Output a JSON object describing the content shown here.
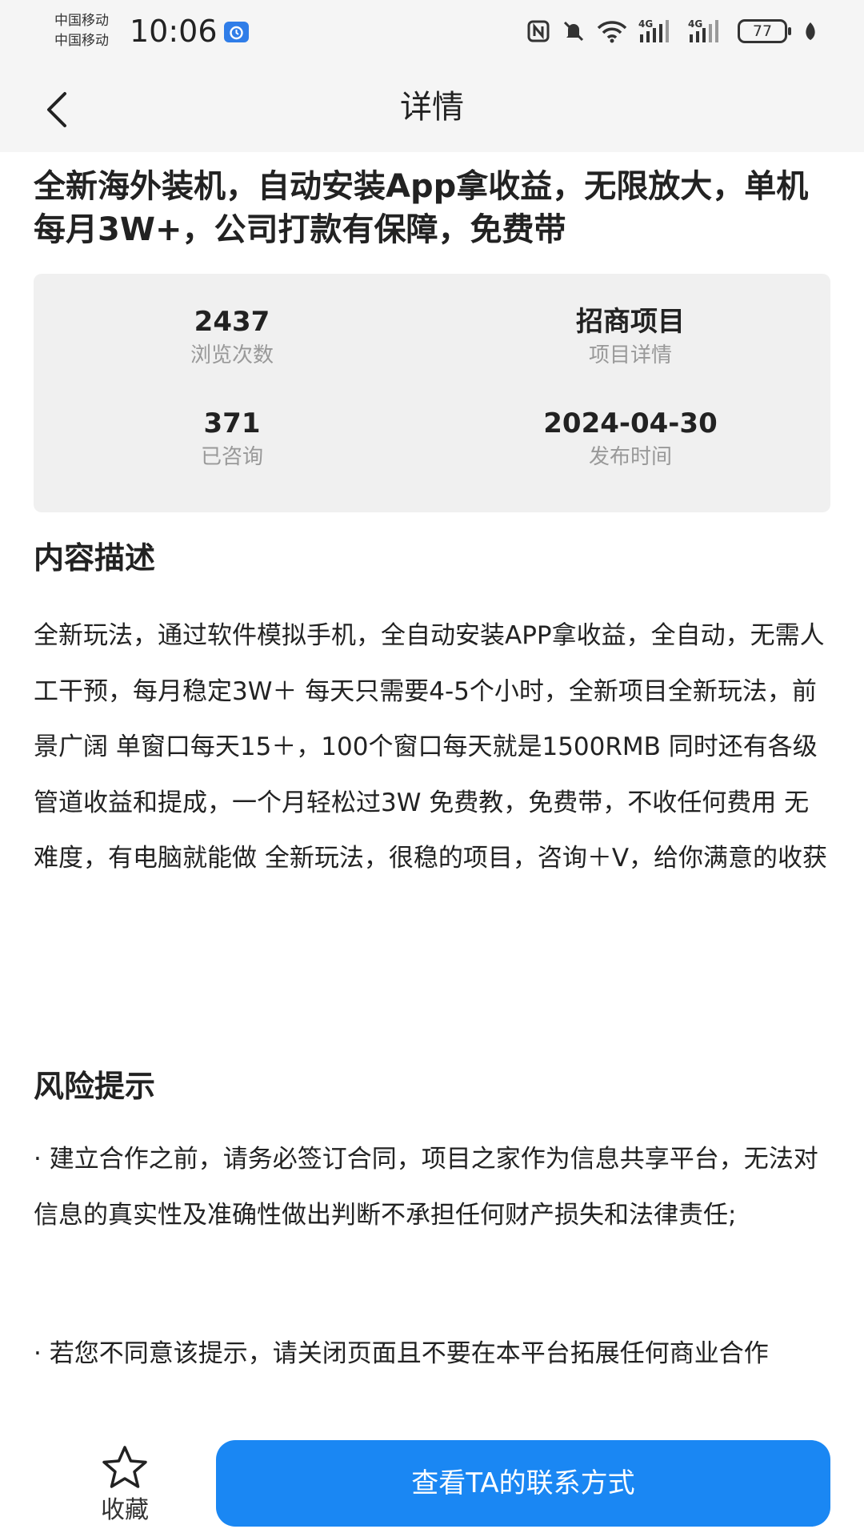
{
  "status_bar": {
    "carrier_1": "中国移动",
    "carrier_2": "中国移动",
    "time": "10:06",
    "battery": "77"
  },
  "nav": {
    "title": "详情"
  },
  "project": {
    "title": "全新海外装机，自动安装App拿收益，无限放大，单机每月3W+，公司打款有保障，免费带"
  },
  "stats": [
    {
      "value": "2437",
      "label": "浏览次数"
    },
    {
      "value": "招商项目",
      "label": "项目详情"
    },
    {
      "value": "371",
      "label": "已咨询"
    },
    {
      "value": "2024-04-30",
      "label": "发布时间"
    }
  ],
  "description": {
    "heading": "内容描述",
    "body": "全新玩法，通过软件模拟手机，全自动安装APP拿收益，全自动，无需人工干预，每月稳定3W＋ 每天只需要4-5个小时，全新项目全新玩法，前景广阔 单窗口每天15＋，100个窗口每天就是1500RMB 同时还有各级管道收益和提成，一个月轻松过3W 免费教，免费带，不收任何费用 无难度，有电脑就能做 全新玩法，很稳的项目，咨询＋V，给你满意的收获"
  },
  "risk": {
    "heading": "风险提示",
    "item_1": "· 建立合作之前，请务必签订合同，项目之家作为信息共享平台，无法对信息的真实性及准确性做出判断不承担任何财产损失和法律责任;",
    "item_2": "· 若您不同意该提示，请关闭页面且不要在本平台拓展任何商业合作"
  },
  "bottom_bar": {
    "favorite_label": "收藏",
    "contact_label": "查看TA的联系方式"
  },
  "colors": {
    "accent": "#1a87f3",
    "header_bg": "#f5f5f5",
    "card_bg": "#f0f0f0",
    "muted_text": "#999999"
  },
  "icons": [
    "alarm-clock-icon",
    "nfc-icon",
    "mute-icon",
    "wifi-icon",
    "signal-4g-icon",
    "battery-icon",
    "leaf-icon",
    "back-arrow-icon",
    "star-icon"
  ]
}
